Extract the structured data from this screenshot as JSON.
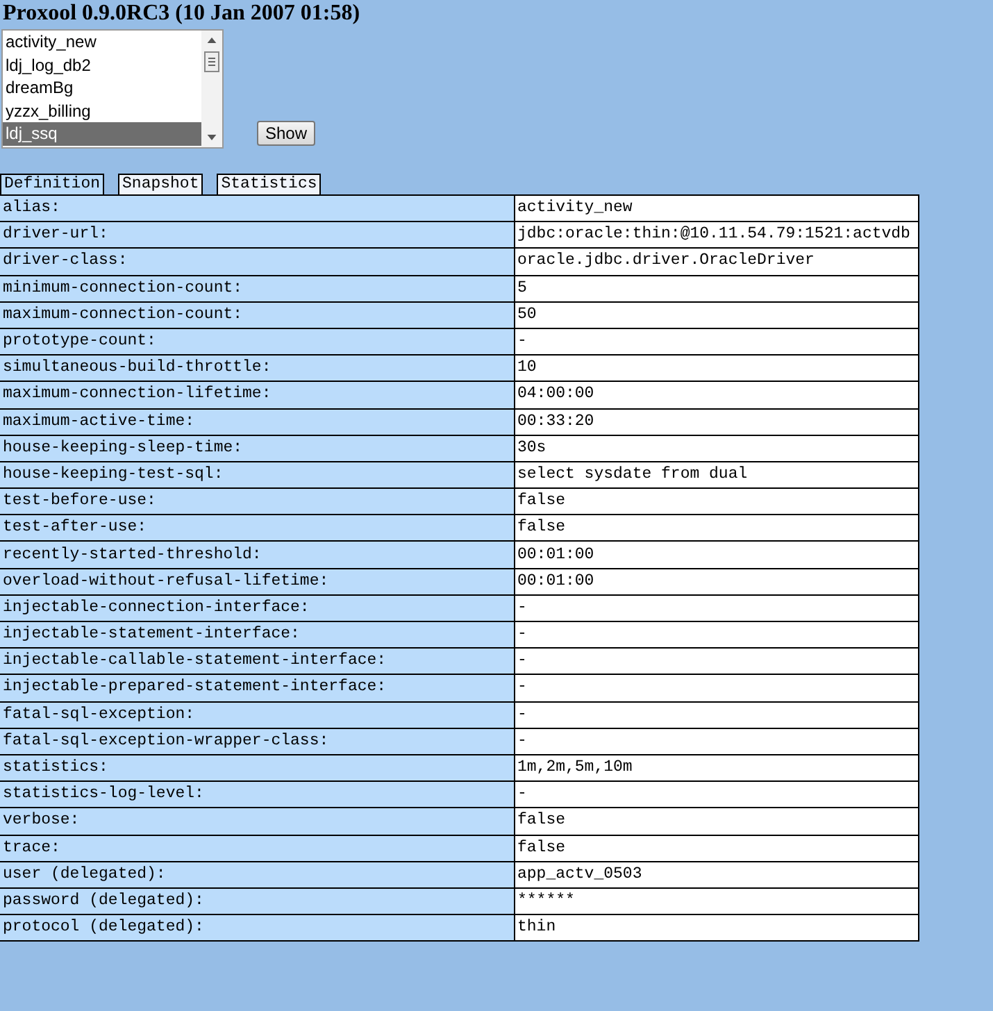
{
  "title": "Proxool 0.9.0RC3 (10 Jan 2007 01:58)",
  "pool_list": [
    {
      "label": "activity_new",
      "selected": false
    },
    {
      "label": "ldj_log_db2",
      "selected": false
    },
    {
      "label": "dreamBg",
      "selected": false
    },
    {
      "label": "yzzx_billing",
      "selected": false
    },
    {
      "label": "ldj_ssq",
      "selected": true
    }
  ],
  "show_button": "Show",
  "tabs": [
    {
      "label": "Definition",
      "selected": true
    },
    {
      "label": "Snapshot",
      "selected": false
    },
    {
      "label": "Statistics",
      "selected": false
    }
  ],
  "properties": [
    {
      "name": "alias:",
      "value": "activity_new"
    },
    {
      "name": "driver-url:",
      "value": "jdbc:oracle:thin:@10.11.54.79:1521:actvdb"
    },
    {
      "name": "driver-class:",
      "value": "oracle.jdbc.driver.OracleDriver"
    },
    {
      "name": "minimum-connection-count:",
      "value": "5"
    },
    {
      "name": "maximum-connection-count:",
      "value": "50"
    },
    {
      "name": "prototype-count:",
      "value": "-"
    },
    {
      "name": "simultaneous-build-throttle:",
      "value": "10"
    },
    {
      "name": "maximum-connection-lifetime:",
      "value": "04:00:00"
    },
    {
      "name": "maximum-active-time:",
      "value": "00:33:20"
    },
    {
      "name": "house-keeping-sleep-time:",
      "value": "30s"
    },
    {
      "name": "house-keeping-test-sql:",
      "value": "select sysdate from dual"
    },
    {
      "name": "test-before-use:",
      "value": "false"
    },
    {
      "name": "test-after-use:",
      "value": "false"
    },
    {
      "name": "recently-started-threshold:",
      "value": "00:01:00"
    },
    {
      "name": "overload-without-refusal-lifetime:",
      "value": "00:01:00"
    },
    {
      "name": "injectable-connection-interface:",
      "value": "-"
    },
    {
      "name": "injectable-statement-interface:",
      "value": "-"
    },
    {
      "name": "injectable-callable-statement-interface:",
      "value": "-"
    },
    {
      "name": "injectable-prepared-statement-interface:",
      "value": "-"
    },
    {
      "name": "fatal-sql-exception:",
      "value": "-"
    },
    {
      "name": "fatal-sql-exception-wrapper-class:",
      "value": "-"
    },
    {
      "name": "statistics:",
      "value": "1m,2m,5m,10m"
    },
    {
      "name": "statistics-log-level:",
      "value": "-"
    },
    {
      "name": "verbose:",
      "value": "false"
    },
    {
      "name": "trace:",
      "value": "false"
    },
    {
      "name": "user (delegated):",
      "value": "app_actv_0503"
    },
    {
      "name": "password (delegated):",
      "value": "******"
    },
    {
      "name": "protocol (delegated):",
      "value": "thin"
    }
  ]
}
